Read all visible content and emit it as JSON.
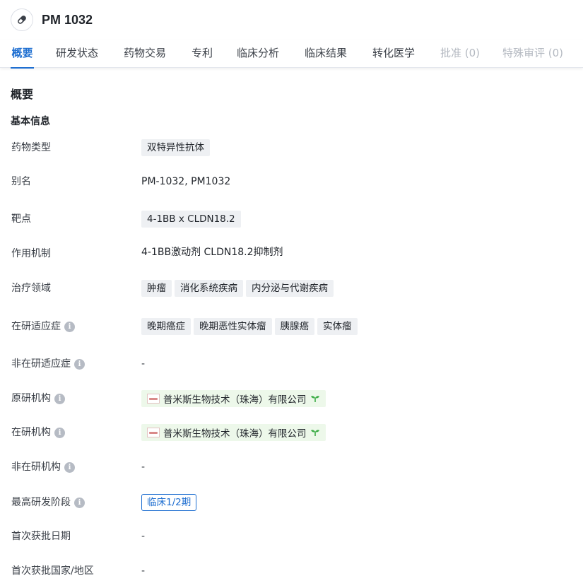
{
  "header": {
    "title": "PM 1032",
    "icon": "pill-icon"
  },
  "tabs": [
    {
      "label": "概要",
      "state": "active"
    },
    {
      "label": "研发状态",
      "state": "normal"
    },
    {
      "label": "药物交易",
      "state": "normal"
    },
    {
      "label": "专利",
      "state": "normal"
    },
    {
      "label": "临床分析",
      "state": "normal"
    },
    {
      "label": "临床结果",
      "state": "normal"
    },
    {
      "label": "转化医学",
      "state": "normal"
    },
    {
      "label": "批准 (0)",
      "state": "disabled"
    },
    {
      "label": "特殊审评 (0)",
      "state": "disabled"
    }
  ],
  "overview": {
    "section_title": "概要",
    "basic_info_title": "基本信息",
    "drug_type": {
      "label": "药物类型",
      "values": [
        "双特异性抗体"
      ]
    },
    "aliases": {
      "label": "别名",
      "value": "PM-1032,  PM1032"
    },
    "targets": {
      "label": "靶点",
      "values": [
        "4-1BB x CLDN18.2"
      ]
    },
    "mechanism": {
      "label": "作用机制",
      "value": "4-1BB激动剂  CLDN18.2抑制剂"
    },
    "therapeutic_areas": {
      "label": "治疗领域",
      "values": [
        "肿瘤",
        "消化系统疾病",
        "内分泌与代谢疾病"
      ]
    },
    "active_indications": {
      "label": "在研适应症",
      "values": [
        "晚期癌症",
        "晚期恶性实体瘤",
        "胰腺癌",
        "实体瘤"
      ]
    },
    "inactive_indications": {
      "label": "非在研适应症",
      "value": "-"
    },
    "originator": {
      "label": "原研机构",
      "value": "普米斯生物技术（珠海）有限公司"
    },
    "active_orgs": {
      "label": "在研机构",
      "value": "普米斯生物技术（珠海）有限公司"
    },
    "inactive_orgs": {
      "label": "非在研机构",
      "value": "-"
    },
    "highest_phase": {
      "label": "最高研发阶段",
      "value": "临床1/2期"
    },
    "first_approval_date": {
      "label": "首次获批日期",
      "value": "-"
    },
    "first_approval_country": {
      "label": "首次获批国家/地区",
      "value": "-"
    }
  },
  "colors": {
    "accent": "#1f6fd1",
    "chip_bg": "#eef0f3",
    "org_bg": "#edf8ea",
    "sprout": "#3fae49",
    "disabled_tab": "#b4b9c1"
  }
}
